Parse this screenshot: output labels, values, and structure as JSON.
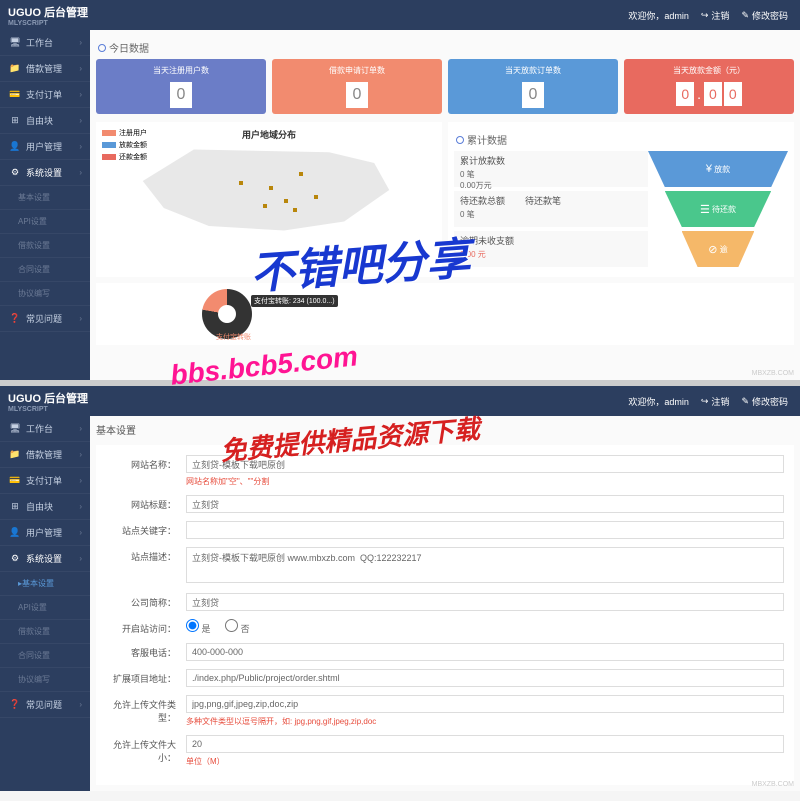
{
  "header": {
    "logo_main": "UGUO",
    "logo_title": "后台管理",
    "logo_sub": "MLYSCRIPT",
    "welcome": "欢迎你，admin",
    "logout": "注销",
    "change_pwd": "修改密码"
  },
  "nav": {
    "items": [
      {
        "icon": "🖥",
        "label": "工作台"
      },
      {
        "icon": "📁",
        "label": "借款管理"
      },
      {
        "icon": "💳",
        "label": "支付订单"
      },
      {
        "icon": "⊞",
        "label": "自由块"
      },
      {
        "icon": "👤",
        "label": "用户管理"
      },
      {
        "icon": "⚙",
        "label": "系统设置"
      }
    ],
    "subs": [
      "基本设置",
      "API设置",
      "借款设置",
      "合同设置",
      "协议编写"
    ],
    "faq": {
      "icon": "❓",
      "label": "常见问题"
    }
  },
  "dashboard": {
    "today_title": "今日数据",
    "cards": [
      {
        "title": "当天注册用户数",
        "value": "0"
      },
      {
        "title": "借款申请订单数",
        "value": "0"
      },
      {
        "title": "当天放款订单数",
        "value": "0"
      },
      {
        "title": "当天放款金额（元）",
        "digits": [
          "0",
          ".",
          "0",
          "0"
        ]
      }
    ],
    "chart_legend": [
      {
        "color": "#f28b6f",
        "label": "注册用户"
      },
      {
        "color": "#5a99d8",
        "label": "放款金额"
      },
      {
        "color": "#e86a5f",
        "label": "还款金额"
      }
    ],
    "chart_title": "用户地域分布",
    "cumulative_title": "累计数据",
    "funnel": [
      {
        "t1": "累计放款数",
        "t2": "0 笔",
        "t3": "0.00万元",
        "tag": "放款"
      },
      {
        "t1": "待还款总额",
        "t1b": "待还款笔",
        "t2": "",
        "t3": "0 笔",
        "tag": "待还款"
      },
      {
        "t1": "逾期未收支额",
        "t2": "0.00 元",
        "t3": "",
        "tag": "逾"
      }
    ],
    "donut_label": "支付宝转账: 234 (100.0...)",
    "donut_legend": "支付宝转账",
    "watermark": "MBXZB.COM"
  },
  "settings": {
    "crumb": "基本设置",
    "fields": {
      "site_name": {
        "label": "网站名称：",
        "value": "立刻贷-模板下载吧原创",
        "hint": "网站名称加\"空\"、\"\"分割"
      },
      "site_short": {
        "label": "网站标题：",
        "value": "立刻贷"
      },
      "site_keywords": {
        "label": "站点关键字：",
        "value": ""
      },
      "site_desc": {
        "label": "站点描述：",
        "value": "立刻贷-模板下载吧原创 www.mbxzb.com  QQ:122232217"
      },
      "company": {
        "label": "公司简称：",
        "value": "立刻贷"
      },
      "enable": {
        "label": "开启站访问：",
        "yes": "是",
        "no": "否"
      },
      "phone": {
        "label": "客服电话：",
        "value": "400-000-000"
      },
      "project_url": {
        "label": "扩展项目地址：",
        "value": "./index.php/Public/project/order.shtml"
      },
      "upload_types": {
        "label": "允许上传文件类型：",
        "value": "jpg,png,gif,jpeg,zip,doc,zip",
        "hint": "多种文件类型以逗号隔开，如: jpg,png,gif,jpeg,zip,doc"
      },
      "upload_size": {
        "label": "允许上传文件大小：",
        "value": "20",
        "hint": "单位（M）"
      }
    }
  },
  "overlay": {
    "wm1": "不错吧分享",
    "wm2": "bbs.bcb5.com",
    "wm3": "免费提供精品资源下载"
  },
  "chart_data": {
    "type": "other",
    "today_cards": {
      "registered_users": 0,
      "loan_apply_orders": 0,
      "loan_paid_orders": 0,
      "loan_paid_amount_yuan": 0.0
    },
    "funnel_cumulative": {
      "loans_count": 0,
      "loans_amount_wan": 0.0,
      "pending_repay_count": 0,
      "overdue_amount_yuan": 0.0
    },
    "donut": {
      "series": [
        {
          "name": "支付宝转账",
          "value": 234,
          "percent": 100.0
        }
      ]
    }
  }
}
